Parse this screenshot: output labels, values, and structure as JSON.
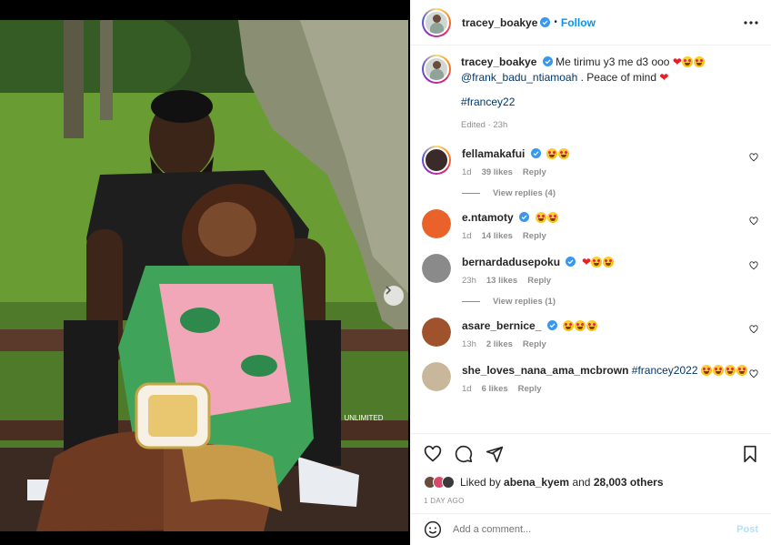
{
  "post": {
    "author": "tracey_boakye",
    "follow_label": "Follow",
    "separator": "•",
    "caption_text": "Me tirimu y3 me d3 ooo",
    "caption_mention": "@frank_badu_ntiamoah",
    "caption_tail": ". Peace of mind",
    "caption_hashtag": "#francey22",
    "edited_meta": "Edited · 23h",
    "watermark": "UNLIMITED"
  },
  "comments": [
    {
      "user": "fellamakafui",
      "time": "1d",
      "likes": "39 likes",
      "reply": "Reply",
      "view_replies": "View replies (4)",
      "avatar_color": "#3a2a2a"
    },
    {
      "user": "e.ntamoty",
      "time": "1d",
      "likes": "14 likes",
      "reply": "Reply",
      "avatar_color": "#e8622a"
    },
    {
      "user": "bernardadusepoku",
      "time": "23h",
      "likes": "13 likes",
      "reply": "Reply",
      "view_replies": "View replies (1)",
      "avatar_color": "#8a8a8a"
    },
    {
      "user": "asare_bernice_",
      "time": "13h",
      "likes": "2 likes",
      "reply": "Reply",
      "avatar_color": "#a0522d"
    },
    {
      "user": "she_loves_nana_ama_mcbrown",
      "hashtag": "#francey2022",
      "time": "1d",
      "likes": "6 likes",
      "reply": "Reply",
      "avatar_color": "#c9b79c"
    }
  ],
  "liked": {
    "prefix": "Liked by",
    "user": "abena_kyem",
    "middle": "and",
    "count": "28,003 others"
  },
  "date": "1 DAY AGO",
  "add_comment": {
    "placeholder": "Add a comment...",
    "post_label": "Post"
  },
  "colors": {
    "link": "#0095f6",
    "mention": "#00376b",
    "heart": "#ed1c24",
    "muted": "#8e8e8e"
  }
}
